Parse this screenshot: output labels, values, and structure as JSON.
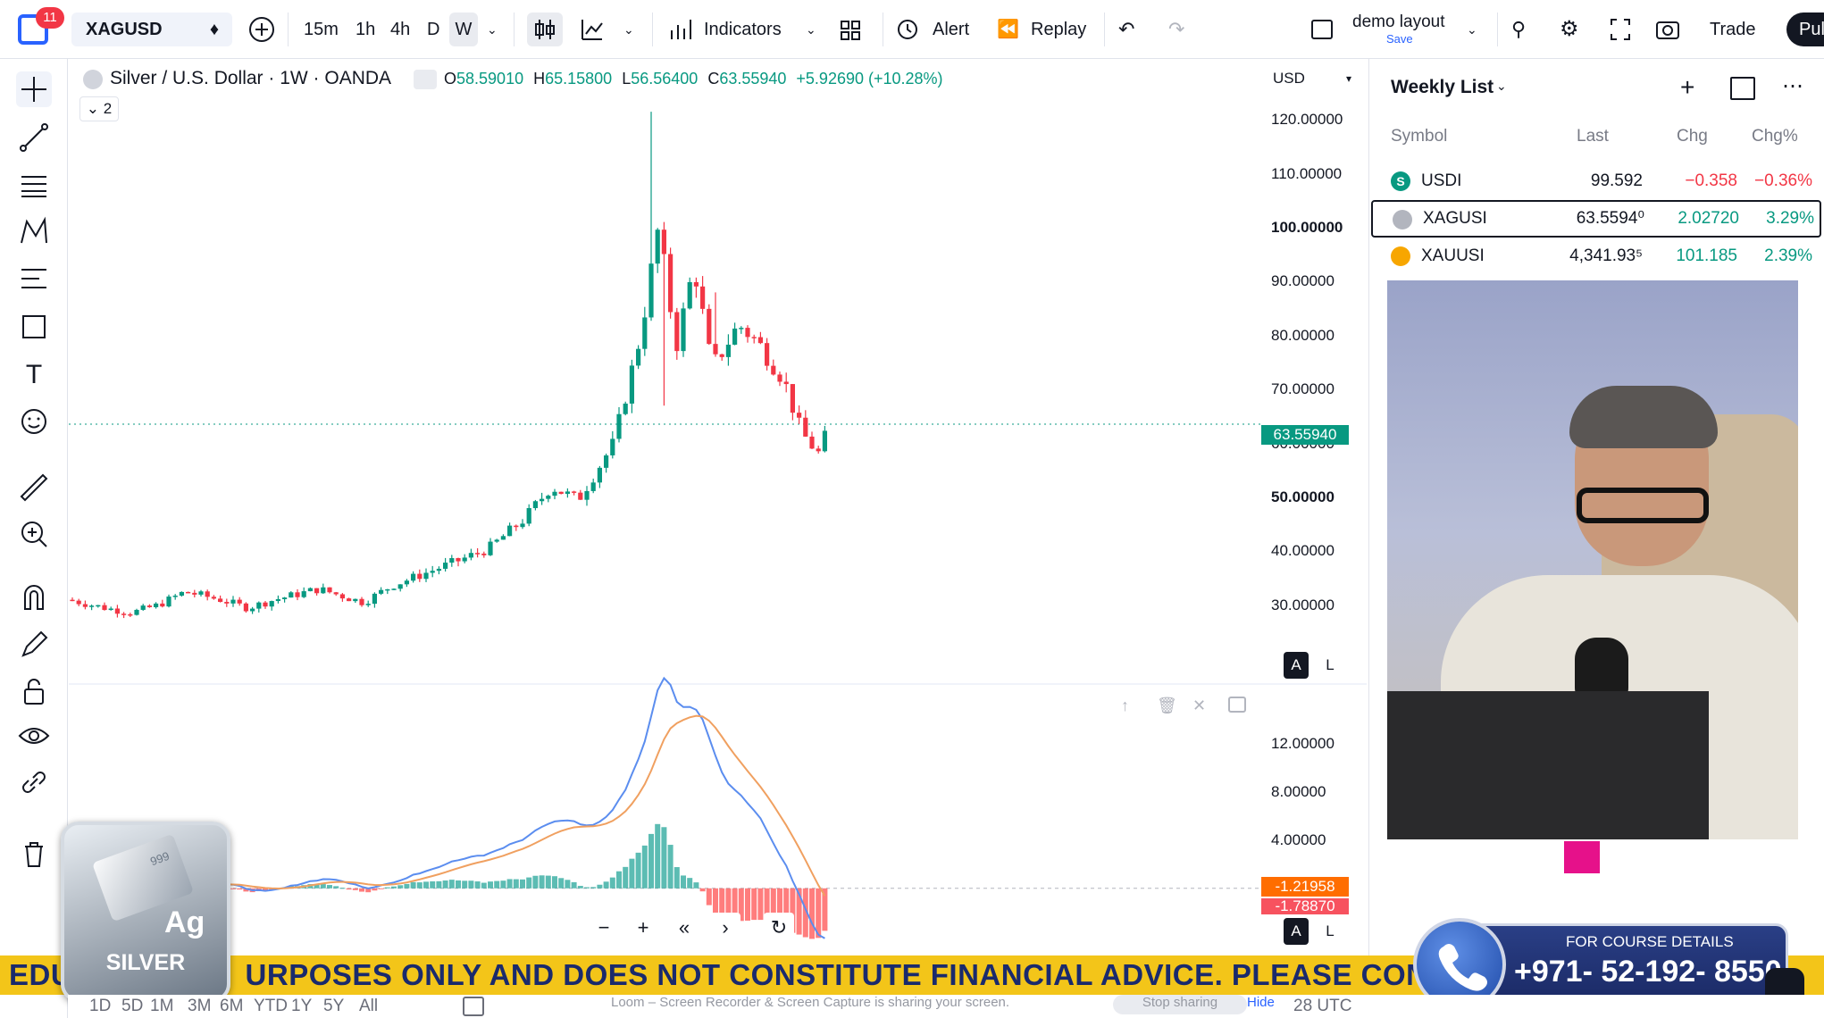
{
  "topbar": {
    "notification_count": "11",
    "symbol": "XAGUSD",
    "intervals": [
      "15m",
      "1h",
      "4h",
      "D",
      "W"
    ],
    "indicators_label": "Indicators",
    "alert_label": "Alert",
    "replay_label": "Replay",
    "layout_name": "demo layout",
    "layout_save": "Save",
    "trade_label": "Trade",
    "publish_label": "Pul"
  },
  "legend": {
    "title": "Silver / U.S. Dollar · 1W · OANDA",
    "open_label": "O",
    "open": "58.59010",
    "high_label": "H",
    "high": "65.15800",
    "low_label": "L",
    "low": "56.56400",
    "close_label": "C",
    "close": "63.55940",
    "change": "+5.92690 (+10.28%)",
    "collapse_count": "2"
  },
  "currency": "USD",
  "chart_data": {
    "type": "candlestick",
    "price_axis": [
      "120.00000",
      "110.00000",
      "100.00000",
      "90.00000",
      "80.00000",
      "70.00000",
      "60.00000",
      "50.00000",
      "40.00000",
      "30.00000"
    ],
    "current_price": "63.55940",
    "ylim": [
      22,
      124
    ],
    "macd_axis": [
      "12.00000",
      "8.00000",
      "4.00000"
    ],
    "macd_values": [
      "-1.21958",
      "-1.78870"
    ],
    "macd_ylim": [
      -3.5,
      14
    ]
  },
  "scale_buttons": {
    "auto": "A",
    "log": "L"
  },
  "nav_buttons": {
    "zoom_out": "−",
    "zoom_in": "+",
    "scroll_back": "«",
    "scroll_fwd": "›",
    "reset": "↻"
  },
  "watchlist": {
    "title": "Weekly List",
    "columns": [
      "Symbol",
      "Last",
      "Chg",
      "Chg%"
    ],
    "rows": [
      {
        "symbol": "USDI",
        "last": "99.592",
        "chg": "−0.358",
        "chgp": "−0.36%",
        "color": "#f23645",
        "badge": "S",
        "badge_color": "#089981"
      },
      {
        "symbol": "XAGUSI",
        "last": "63.5594⁰",
        "chg": "2.02720",
        "chgp": "3.29%",
        "color": "#089981",
        "badge": "",
        "badge_color": "#b2b5be"
      },
      {
        "symbol": "XAUUSI",
        "last": "4,341.93⁵",
        "chg": "101.185",
        "chgp": "2.39%",
        "color": "#089981",
        "badge": "",
        "badge_color": "#f7a600"
      }
    ]
  },
  "ticker_text": "EDUCATIONAL PURPOSES ONLY AND DOES NOT CONSTITUTE FINANCIAL ADVICE. PLEASE CONDUCT YOUR OWN RESEARCH",
  "ticker_visible": "EDU                    URPOSES ONLY AND DOES NOT CONSTITUTE FINANCIAL ADVICE. PLEASE CONDUCT YO",
  "contact": {
    "line1": "FOR COURSE DETAILS",
    "phone": "+971- 52-192- 8550"
  },
  "silver_badge": {
    "symbol": "Ag",
    "label": "SILVER",
    "purity": "999"
  },
  "bottom_ranges": [
    "1D",
    "5D",
    "1M",
    "3M",
    "6M",
    "YTD",
    "1Y",
    "5Y",
    "All"
  ],
  "bottom_time": "28 UTC",
  "share_notice": "Loom – Screen Recorder & Screen Capture is sharing your screen.",
  "stop_sharing": "Stop sharing",
  "hide": "Hide"
}
